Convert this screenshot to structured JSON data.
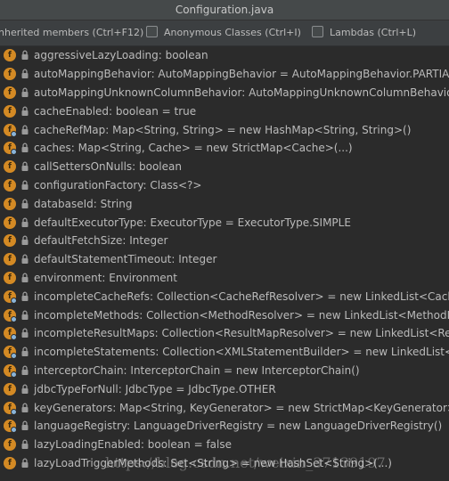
{
  "window": {
    "title": "Configuration.java"
  },
  "options": {
    "inherited": "nherited members (Ctrl+F12)",
    "anonymous": "Anonymous Classes (Ctrl+I)",
    "lambdas": "Lambdas (Ctrl+L)"
  },
  "colors": {
    "field_icon": "#d48a24",
    "list_bg": "#2b2b2b",
    "text": "#bbbbbb"
  },
  "icons": {
    "field": "field-icon",
    "visibility": "private-lock-icon",
    "static_marker": "static-dot"
  },
  "members": [
    {
      "text": "aggressiveLazyLoading: boolean",
      "static": false
    },
    {
      "text": "autoMappingBehavior: AutoMappingBehavior = AutoMappingBehavior.PARTIAL",
      "static": false
    },
    {
      "text": "autoMappingUnknownColumnBehavior: AutoMappingUnknownColumnBehavior",
      "static": false
    },
    {
      "text": "cacheEnabled: boolean = true",
      "static": false
    },
    {
      "text": "cacheRefMap: Map<String, String> = new HashMap<String, String>()",
      "static": true
    },
    {
      "text": "caches: Map<String, Cache> = new StrictMap<Cache>(...)",
      "static": true
    },
    {
      "text": "callSettersOnNulls: boolean",
      "static": false
    },
    {
      "text": "configurationFactory: Class<?>",
      "static": false
    },
    {
      "text": "databaseId: String",
      "static": false
    },
    {
      "text": "defaultExecutorType: ExecutorType = ExecutorType.SIMPLE",
      "static": false
    },
    {
      "text": "defaultFetchSize: Integer",
      "static": false
    },
    {
      "text": "defaultStatementTimeout: Integer",
      "static": false
    },
    {
      "text": "environment: Environment",
      "static": false
    },
    {
      "text": "incompleteCacheRefs: Collection<CacheRefResolver> = new LinkedList<CacheRe",
      "static": true
    },
    {
      "text": "incompleteMethods: Collection<MethodResolver> = new LinkedList<MethodRe",
      "static": true
    },
    {
      "text": "incompleteResultMaps: Collection<ResultMapResolver> = new LinkedList<Resul",
      "static": true
    },
    {
      "text": "incompleteStatements: Collection<XMLStatementBuilder> = new LinkedList<XM",
      "static": true
    },
    {
      "text": "interceptorChain: InterceptorChain = new InterceptorChain()",
      "static": true
    },
    {
      "text": "jdbcTypeForNull: JdbcType = JdbcType.OTHER",
      "static": false
    },
    {
      "text": "keyGenerators: Map<String, KeyGenerator> = new StrictMap<KeyGenerator>(...)",
      "static": true
    },
    {
      "text": "languageRegistry: LanguageDriverRegistry = new LanguageDriverRegistry()",
      "static": true
    },
    {
      "text": "lazyLoadingEnabled: boolean = false",
      "static": false
    },
    {
      "text": "lazyLoadTriggerMethods: Set<String> = new HashSet<String>(...)",
      "static": false
    }
  ],
  "watermark": "https://blog.csdn.net/weixin_37139197"
}
